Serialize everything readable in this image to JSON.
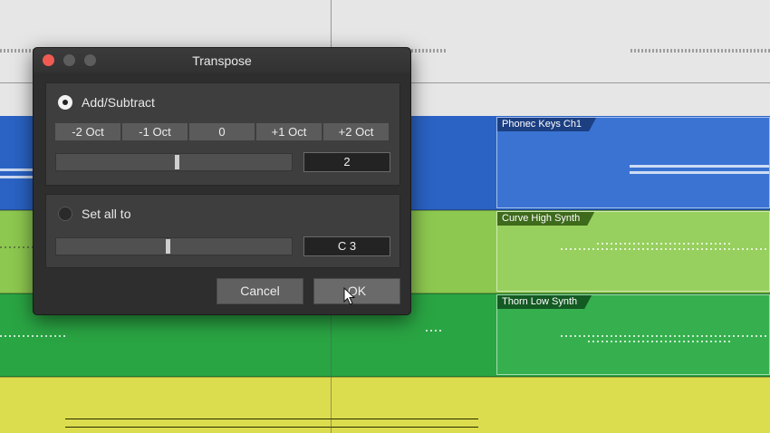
{
  "dialog": {
    "title": "Transpose",
    "add_subtract": {
      "label": "Add/Subtract",
      "selected": true,
      "octave_buttons": [
        "-2 Oct",
        "-1 Oct",
        "0",
        "+1 Oct",
        "+2 Oct"
      ],
      "value": "2"
    },
    "set_all_to": {
      "label": "Set all to",
      "selected": false,
      "value": "C 3"
    },
    "buttons": {
      "cancel": "Cancel",
      "ok": "OK"
    }
  },
  "tracks": [
    {
      "region_name": "Phonec Keys Ch1",
      "color": "#2a63c4"
    },
    {
      "region_name": "Curve High Synth",
      "color": "#8dc850"
    },
    {
      "region_name": "Thorn Low Synth",
      "color": "#2aa543"
    }
  ],
  "colors": {
    "lane_yellow": "#dcdd4e",
    "close_button": "#ef5b52"
  }
}
